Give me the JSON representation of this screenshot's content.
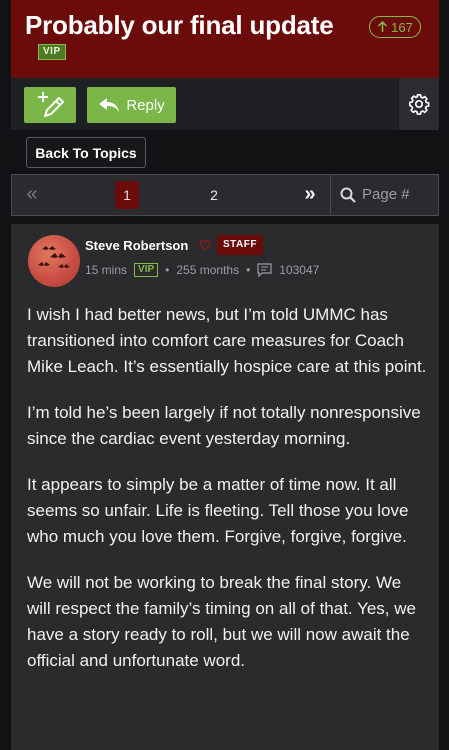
{
  "header": {
    "title": "Probably our final update",
    "upvotes": "167",
    "vip_tag": "VIP"
  },
  "toolbar": {
    "new_topic_icon": "add-edit-icon",
    "reply_label": "Reply",
    "settings_icon": "gear-icon"
  },
  "nav": {
    "back_label": "Back To Topics"
  },
  "pagination": {
    "first_glyph": "«",
    "page_1": "1",
    "page_2": "2",
    "last_glyph": "»",
    "search_placeholder": "Page #",
    "current_page": 1
  },
  "post": {
    "author": "Steve Robertson",
    "role_badge": "STAFF",
    "time": "15 mins",
    "vip_badge": "VIP",
    "membership": "255 months",
    "post_count": "103047",
    "paragraphs": [
      "I wish I had better news, but I’m told UMMC has transitioned into comfort care measures for Coach Mike Leach. It’s essentially hospice care at this point.",
      "I’m told he’s been largely if not totally nonresponsive since the cardiac event yesterday morning.",
      "It appears to simply be a matter of time now. It all seems so unfair. Life is fleeting. Tell those you love who much you love them. Forgive, forgive, forgive.",
      "We will not be working to break the final story. We will respect the family’s timing on all of that. Yes, we have a story ready to roll, but we will now await the official and unfortunate word."
    ]
  },
  "colors": {
    "header_bg": "#6b0c0a",
    "accent_green": "#7ab648",
    "post_bg": "#2b2a2c"
  }
}
